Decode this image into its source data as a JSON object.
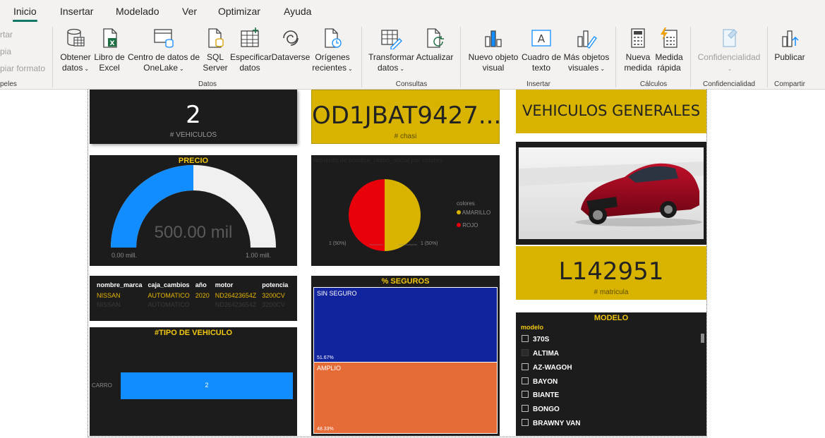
{
  "tabs": [
    "Inicio",
    "Insertar",
    "Modelado",
    "Ver",
    "Optimizar",
    "Ayuda"
  ],
  "clipboard": {
    "cut": "rtar",
    "copy": "pia",
    "format": "piar formato",
    "group": "peles"
  },
  "buttons": {
    "get_data": [
      "Obtener",
      "datos"
    ],
    "excel": [
      "Libro de",
      "Excel"
    ],
    "onelake": [
      "Centro de datos de",
      "OneLake"
    ],
    "sql": [
      "SQL",
      "Server"
    ],
    "enter_data": [
      "Especificar",
      "datos"
    ],
    "dataverse": [
      "Dataverse"
    ],
    "recent": [
      "Orígenes",
      "recientes"
    ],
    "transform": [
      "Transformar",
      "datos"
    ],
    "refresh": [
      "Actualizar"
    ],
    "new_visual": [
      "Nuevo objeto",
      "visual"
    ],
    "text_box": [
      "Cuadro de",
      "texto"
    ],
    "more_visuals": [
      "Más objetos",
      "visuales"
    ],
    "new_measure": [
      "Nueva",
      "medida"
    ],
    "quick_measure": [
      "Medida",
      "rápida"
    ],
    "sensitivity": [
      "Confidencialidad"
    ],
    "publish": [
      "Publicar"
    ]
  },
  "groups": {
    "data": "Datos",
    "queries": "Consultas",
    "insert": "Insertar",
    "calc": "Cálculos",
    "sensitivity": "Confidencialidad",
    "share": "Compartir"
  },
  "cards": {
    "vehiculos": {
      "value": "2",
      "label": "# VEHICULOS"
    },
    "chasis": {
      "value": "OD1JBAT9427...",
      "label": "# chasi"
    },
    "title": {
      "value": "VEHICULOS GENERALES"
    },
    "matricula": {
      "value": "L142951",
      "label": "# matricula"
    }
  },
  "gauge": {
    "title": "PRECIO",
    "value_label": "500.00 mil",
    "min_label": "0.00 mill.",
    "max_label": "1.00 mill.",
    "fraction": 0.5
  },
  "pie": {
    "title": "recuento de nombre_razon_social por colores",
    "legend_title": "colores",
    "slices": [
      {
        "name": "AMARILLO",
        "value": 1,
        "label": "1 (50%)",
        "color": "#d8b400"
      },
      {
        "name": "ROJO",
        "value": 1,
        "label": "1 (50%)",
        "color": "#e8000b"
      }
    ]
  },
  "table": {
    "columns": [
      "nombre_marca",
      "caja_cambios",
      "año",
      "motor",
      "potencia"
    ],
    "rows": [
      [
        "NISSAN",
        "AUTOMATICO",
        "2020",
        "ND26423654Z",
        "3200CV"
      ]
    ],
    "ghost": [
      "NISSAN",
      "AUTOMATICO",
      "",
      "ND26423654Z",
      "3200CV"
    ]
  },
  "seguros": {
    "title": "% SEGUROS",
    "items": [
      {
        "name": "SIN SEGURO",
        "pct": "51.67%",
        "value": 51.67,
        "color": "#12239e"
      },
      {
        "name": "AMPLIO",
        "pct": "48.33%",
        "value": 48.33,
        "color": "#e66c37"
      }
    ]
  },
  "tipo": {
    "title": "#TIPO DE VEHICULO",
    "category": "CARRO",
    "value_label": "2",
    "fraction": 1.0,
    "color": "#118dff"
  },
  "modelo": {
    "title": "MODELO",
    "field": "modelo",
    "items": [
      "370S",
      "ALTIMA",
      "AZ-WAGOH",
      "BAYON",
      "BIANTE",
      "BONGO",
      "BRAWNY VAN"
    ],
    "selected": "ALTIMA"
  },
  "colors": {
    "accent": "#117865",
    "gold": "#d8b400",
    "tile": "#1c1c1c",
    "blue": "#118dff",
    "gauge_rest": "#f0f0f0"
  }
}
